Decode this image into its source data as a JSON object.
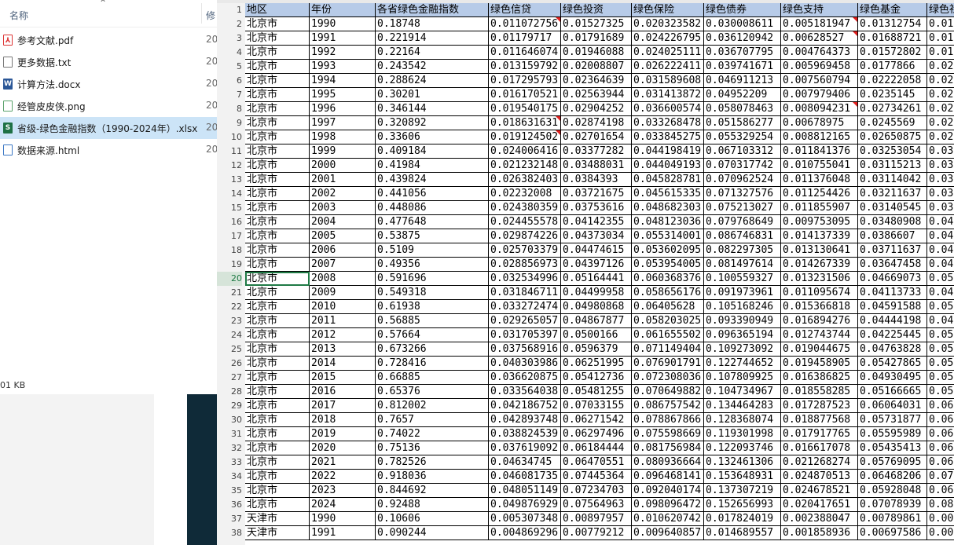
{
  "explorer": {
    "col_name": "名称",
    "col_modified": "修",
    "files": [
      {
        "name": "参考文献.pdf",
        "date": "20",
        "icon": "pdf-icon"
      },
      {
        "name": "更多数据.txt",
        "date": "20",
        "icon": "txt-icon"
      },
      {
        "name": "计算方法.docx",
        "date": "20",
        "icon": "docx-icon"
      },
      {
        "name": "经管皮皮侠.png",
        "date": "20",
        "icon": "png-icon"
      },
      {
        "name": "省级-绿色金融指数（1990-2024年）.xlsx",
        "date": "20",
        "icon": "xlsx-icon",
        "selected": true
      },
      {
        "name": "数据来源.html",
        "date": "20",
        "icon": "html-icon"
      }
    ],
    "status": "01 KB"
  },
  "sheet": {
    "headers": [
      "地区",
      "年份",
      "各省绿色金融指数",
      "绿色信贷",
      "绿色投资",
      "绿色保险",
      "绿色债券",
      "绿色支持",
      "绿色基金",
      "绿色社"
    ],
    "active_row": "20",
    "rows": [
      [
        "2",
        "北京市",
        "1990",
        "0.18748",
        "0.011072756",
        "0.01527325",
        "0.020323582",
        "0.030008611",
        "0.005181947",
        "0.01312754",
        "0.01"
      ],
      [
        "3",
        "北京市",
        "1991",
        "0.221914",
        "0.01179717",
        "0.01791689",
        "0.024226795",
        "0.036120942",
        "0.00628527",
        "0.01688721",
        "0.01"
      ],
      [
        "4",
        "北京市",
        "1992",
        "0.22164",
        "0.011646074",
        "0.01946088",
        "0.024025111",
        "0.036707795",
        "0.004764373",
        "0.01572802",
        "0.01"
      ],
      [
        "5",
        "北京市",
        "1993",
        "0.243542",
        "0.013159792",
        "0.02008807",
        "0.026222411",
        "0.039741671",
        "0.005969458",
        "0.0177866",
        "0.02"
      ],
      [
        "6",
        "北京市",
        "1994",
        "0.288624",
        "0.017295793",
        "0.02364639",
        "0.031589608",
        "0.046911213",
        "0.007560794",
        "0.02222058",
        "0.02"
      ],
      [
        "7",
        "北京市",
        "1995",
        "0.30201",
        "0.016170521",
        "0.02563944",
        "0.031413872",
        "0.04952209",
        "0.007979406",
        "0.0235145",
        "0.02"
      ],
      [
        "8",
        "北京市",
        "1996",
        "0.346144",
        "0.019540175",
        "0.02904252",
        "0.036600574",
        "0.058078463",
        "0.008094231",
        "0.02734261",
        "0.02"
      ],
      [
        "9",
        "北京市",
        "1997",
        "0.320892",
        "0.018631631",
        "0.02874198",
        "0.033268478",
        "0.051586277",
        "0.00678975",
        "0.0245569",
        "0.02"
      ],
      [
        "10",
        "北京市",
        "1998",
        "0.33606",
        "0.019124502",
        "0.02701654",
        "0.033845275",
        "0.055329254",
        "0.008812165",
        "0.02650875",
        "0.02"
      ],
      [
        "11",
        "北京市",
        "1999",
        "0.409184",
        "0.024006416",
        "0.03377282",
        "0.044198419",
        "0.067103312",
        "0.011841376",
        "0.03253054",
        "0.03"
      ],
      [
        "12",
        "北京市",
        "2000",
        "0.41984",
        "0.021232148",
        "0.03488031",
        "0.044049193",
        "0.070317742",
        "0.010755041",
        "0.03115213",
        "0.03"
      ],
      [
        "13",
        "北京市",
        "2001",
        "0.439824",
        "0.026382403",
        "0.0384393",
        "0.045828781",
        "0.070962524",
        "0.011376048",
        "0.03114042",
        "0.03"
      ],
      [
        "14",
        "北京市",
        "2002",
        "0.441056",
        "0.02232008",
        "0.03721675",
        "0.045615335",
        "0.071327576",
        "0.011254426",
        "0.03211637",
        "0.03"
      ],
      [
        "15",
        "北京市",
        "2003",
        "0.448086",
        "0.024380359",
        "0.03753616",
        "0.048682303",
        "0.075213027",
        "0.011855907",
        "0.03140545",
        "0.03"
      ],
      [
        "16",
        "北京市",
        "2004",
        "0.477648",
        "0.024455578",
        "0.04142355",
        "0.048123036",
        "0.079768649",
        "0.009753095",
        "0.03480908",
        "0.04"
      ],
      [
        "17",
        "北京市",
        "2005",
        "0.53875",
        "0.029874226",
        "0.04373034",
        "0.055314001",
        "0.086746831",
        "0.014137339",
        "0.0386607",
        "0.04"
      ],
      [
        "18",
        "北京市",
        "2006",
        "0.5109",
        "0.025703379",
        "0.04474615",
        "0.053602095",
        "0.082297305",
        "0.013130641",
        "0.03711637",
        "0.04"
      ],
      [
        "19",
        "北京市",
        "2007",
        "0.49356",
        "0.028856973",
        "0.04397126",
        "0.053954005",
        "0.081497614",
        "0.014267339",
        "0.03647458",
        "0.04"
      ],
      [
        "20",
        "北京市",
        "2008",
        "0.591696",
        "0.032534996",
        "0.05164441",
        "0.060368376",
        "0.100559327",
        "0.013231506",
        "0.04669073",
        "0.05"
      ],
      [
        "21",
        "北京市",
        "2009",
        "0.549318",
        "0.031846711",
        "0.04499958",
        "0.058656176",
        "0.091973961",
        "0.011095674",
        "0.04113733",
        "0.04"
      ],
      [
        "22",
        "北京市",
        "2010",
        "0.61938",
        "0.033272474",
        "0.04980868",
        "0.06405628",
        "0.105168246",
        "0.015366818",
        "0.04591588",
        "0.05"
      ],
      [
        "23",
        "北京市",
        "2011",
        "0.56885",
        "0.029265057",
        "0.04867877",
        "0.058203025",
        "0.093390949",
        "0.016894276",
        "0.04444198",
        "0.04"
      ],
      [
        "24",
        "北京市",
        "2012",
        "0.57664",
        "0.031705397",
        "0.0500166",
        "0.061655502",
        "0.096365194",
        "0.012743744",
        "0.04225445",
        "0.05"
      ],
      [
        "25",
        "北京市",
        "2013",
        "0.673266",
        "0.037568916",
        "0.0596379",
        "0.071149404",
        "0.109273092",
        "0.019044675",
        "0.04763828",
        "0.05"
      ],
      [
        "26",
        "北京市",
        "2014",
        "0.728416",
        "0.040303986",
        "0.06251995",
        "0.076901791",
        "0.122744652",
        "0.019458905",
        "0.05427865",
        "0.05"
      ],
      [
        "27",
        "北京市",
        "2015",
        "0.66885",
        "0.036620875",
        "0.05412736",
        "0.072308036",
        "0.107809925",
        "0.016386825",
        "0.04930495",
        "0.05"
      ],
      [
        "28",
        "北京市",
        "2016",
        "0.65376",
        "0.033564038",
        "0.05481255",
        "0.070649882",
        "0.104734967",
        "0.018558285",
        "0.05166665",
        "0.05"
      ],
      [
        "29",
        "北京市",
        "2017",
        "0.812002",
        "0.042186752",
        "0.07033155",
        "0.086757542",
        "0.134464283",
        "0.017287523",
        "0.06064031",
        "0.06"
      ],
      [
        "30",
        "北京市",
        "2018",
        "0.7657",
        "0.042893748",
        "0.06271542",
        "0.078867866",
        "0.128368074",
        "0.018877568",
        "0.05731877",
        "0.06"
      ],
      [
        "31",
        "北京市",
        "2019",
        "0.74022",
        "0.038824539",
        "0.06297496",
        "0.075598669",
        "0.119301998",
        "0.017917765",
        "0.05595989",
        "0.06"
      ],
      [
        "32",
        "北京市",
        "2020",
        "0.75136",
        "0.037619092",
        "0.06184444",
        "0.081756984",
        "0.122093746",
        "0.016617078",
        "0.05435413",
        "0.06"
      ],
      [
        "33",
        "北京市",
        "2021",
        "0.782526",
        "0.04634745",
        "0.06470551",
        "0.080936664",
        "0.132461306",
        "0.021268274",
        "0.05769095",
        "0.06"
      ],
      [
        "34",
        "北京市",
        "2022",
        "0.918036",
        "0.046081735",
        "0.07445364",
        "0.096468141",
        "0.153648931",
        "0.024870513",
        "0.06468206",
        "0.07"
      ],
      [
        "35",
        "北京市",
        "2023",
        "0.844692",
        "0.048051149",
        "0.07234703",
        "0.092040174",
        "0.137307219",
        "0.024678521",
        "0.05928048",
        "0.06"
      ],
      [
        "36",
        "北京市",
        "2024",
        "0.92488",
        "0.049876929",
        "0.07564963",
        "0.098096472",
        "0.152656993",
        "0.020417651",
        "0.07078939",
        "0.08"
      ],
      [
        "37",
        "天津市",
        "1990",
        "0.10606",
        "0.005307348",
        "0.00897957",
        "0.010620742",
        "0.017824019",
        "0.002388047",
        "0.00789861",
        "0.00"
      ],
      [
        "38",
        "天津市",
        "1991",
        "0.090244",
        "0.004869296",
        "0.00779212",
        "0.009640857",
        "0.014689557",
        "0.001858936",
        "0.00697586",
        "0.00"
      ]
    ]
  }
}
